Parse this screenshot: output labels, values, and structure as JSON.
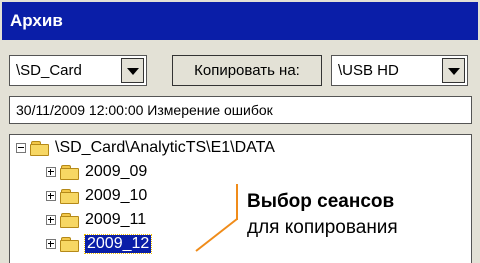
{
  "window": {
    "title": "Архив"
  },
  "source_combo": {
    "value": "\\SD_Card"
  },
  "copy_button": {
    "label": "Копировать на:"
  },
  "target_combo": {
    "value": "\\USB HD"
  },
  "session_info": {
    "value": "30/11/2009 12:00:00 Измерение ошибок"
  },
  "tree": {
    "root_path": "\\SD_Card\\AnalyticTS\\E1\\DATA",
    "items": [
      {
        "label": "2009_09",
        "selected": false
      },
      {
        "label": "2009_10",
        "selected": false
      },
      {
        "label": "2009_11",
        "selected": false
      },
      {
        "label": "2009_12",
        "selected": true
      }
    ]
  },
  "annotation": {
    "line1": "Выбор сеансов",
    "line2": "для копирования"
  },
  "colors": {
    "titlebar": "#0a1ea8",
    "callout": "#f08c1a",
    "folder": "#f7d764"
  }
}
